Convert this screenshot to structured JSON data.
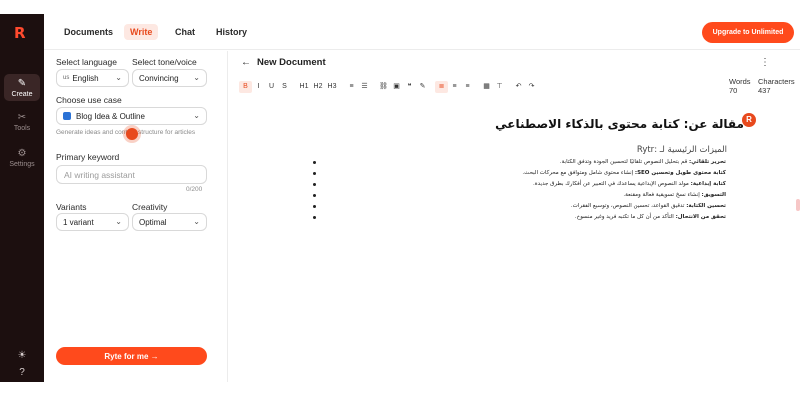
{
  "brand": {
    "logo": "R"
  },
  "rail": {
    "items": [
      {
        "label": "Create",
        "icon": "✎"
      },
      {
        "label": "Tools",
        "icon": "✂"
      },
      {
        "label": "Settings",
        "icon": "⚙"
      }
    ],
    "theme_icon": "☀",
    "help_icon": "?"
  },
  "nav": {
    "tabs": [
      {
        "label": "Documents"
      },
      {
        "label": "Write"
      },
      {
        "label": "Chat"
      },
      {
        "label": "History"
      }
    ],
    "upgrade_label": "Upgrade to Unlimited"
  },
  "panel": {
    "language_label": "Select language",
    "language_value": "English",
    "language_prefix": "us",
    "tone_label": "Select tone/voice",
    "tone_value": "Convincing",
    "usecase_label": "Choose use case",
    "usecase_value": "Blog Idea & Outline",
    "usecase_help": "Generate ideas and content structure for articles",
    "keyword_label": "Primary keyword",
    "keyword_placeholder": "AI writing assistant",
    "keyword_counter": "0/200",
    "variants_label": "Variants",
    "variants_value": "1 variant",
    "creativity_label": "Creativity",
    "creativity_value": "Optimal",
    "ryte_label": "Ryte for me →"
  },
  "editor": {
    "back_icon": "←",
    "title": "New Document",
    "words_label": "Words",
    "words_value": "70",
    "chars_label": "Characters",
    "chars_value": "437",
    "kebab": "⋮",
    "toolbar": {
      "bold": "B",
      "italic": "I",
      "underline": "U",
      "strike": "S",
      "h1": "H1",
      "h2": "H2",
      "h3": "H3",
      "bullets": "≡",
      "numbered": "☰",
      "link": "⛓",
      "image": "▣",
      "quote": "❝",
      "pen": "✎",
      "align_left": "≣",
      "align_center": "≡",
      "align_right": "≡",
      "table": "▦",
      "clear": "⊤",
      "undo": "↶",
      "redo": "↷"
    },
    "heading": "مقالة عن: كتابة محتوى بالذكاء الاصطناعي",
    "avatar": "R",
    "subheading": "الميزات الرئيسية لـ :Rytr",
    "features": [
      {
        "term": "تحرير تلقائي:",
        "text": "قم بتحليل النصوص تلقائيًا لتحسين الجودة وتدفق الكتابة."
      },
      {
        "term": "كتابة محتوى طويل وتحسين SEO:",
        "text": "إنشاء محتوى شامل ومتوافق مع محركات البحث."
      },
      {
        "term": "كتابة إبداعية:",
        "text": "مولد النصوص الإبداعية يساعدك في التعبير عن أفكارك بطرق جديدة."
      },
      {
        "term": "التسويق:",
        "text": "إنشاء نسخ تسويقية فعالة ومقنعة."
      },
      {
        "term": "تحسين الكتابة:",
        "text": "تدقيق القواعد، تحسين النصوص، وتوسيع الفقرات."
      },
      {
        "term": "تحقق من الانتحال:",
        "text": "التأكد من أن كل ما تكتبه فريد وغير منسوخ."
      }
    ]
  }
}
